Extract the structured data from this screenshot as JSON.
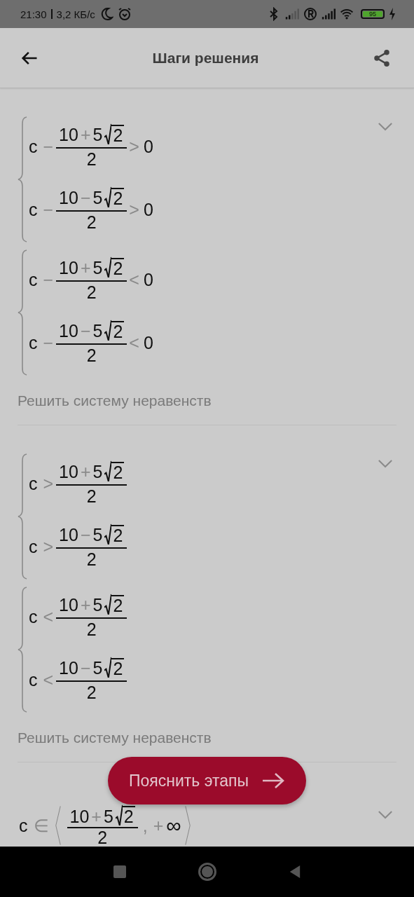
{
  "status_bar": {
    "time": "21:30",
    "speed": "3,2 КБ/с",
    "battery": "95"
  },
  "header": {
    "title": "Шаги решения"
  },
  "steps": [
    {
      "systems": [
        {
          "rows": [
            {
              "kind": "difference",
              "variable": "c",
              "operator": "−",
              "numerator": {
                "a": "10",
                "sign": "+",
                "b": "5",
                "radicand": "2"
              },
              "denominator": "2",
              "relation": ">",
              "rhs": "0"
            },
            {
              "kind": "difference",
              "variable": "c",
              "operator": "−",
              "numerator": {
                "a": "10",
                "sign": "−",
                "b": "5",
                "radicand": "2"
              },
              "denominator": "2",
              "relation": ">",
              "rhs": "0"
            }
          ]
        },
        {
          "rows": [
            {
              "kind": "difference",
              "variable": "c",
              "operator": "−",
              "numerator": {
                "a": "10",
                "sign": "+",
                "b": "5",
                "radicand": "2"
              },
              "denominator": "2",
              "relation": "<",
              "rhs": "0"
            },
            {
              "kind": "difference",
              "variable": "c",
              "operator": "−",
              "numerator": {
                "a": "10",
                "sign": "−",
                "b": "5",
                "radicand": "2"
              },
              "denominator": "2",
              "relation": "<",
              "rhs": "0"
            }
          ]
        }
      ],
      "caption": "Решить систему неравенств"
    },
    {
      "systems": [
        {
          "rows": [
            {
              "kind": "comparison",
              "variable": "c",
              "relation": ">",
              "numerator": {
                "a": "10",
                "sign": "+",
                "b": "5",
                "radicand": "2"
              },
              "denominator": "2"
            },
            {
              "kind": "comparison",
              "variable": "c",
              "relation": ">",
              "numerator": {
                "a": "10",
                "sign": "−",
                "b": "5",
                "radicand": "2"
              },
              "denominator": "2"
            }
          ]
        },
        {
          "rows": [
            {
              "kind": "comparison",
              "variable": "c",
              "relation": "<",
              "numerator": {
                "a": "10",
                "sign": "+",
                "b": "5",
                "radicand": "2"
              },
              "denominator": "2"
            },
            {
              "kind": "comparison",
              "variable": "c",
              "relation": "<",
              "numerator": {
                "a": "10",
                "sign": "−",
                "b": "5",
                "radicand": "2"
              },
              "denominator": "2"
            }
          ]
        }
      ],
      "caption": "Решить систему неравенств"
    },
    {
      "rows": [
        {
          "kind": "interval",
          "variable": "c",
          "relation": "∈",
          "numerator": {
            "a": "10",
            "sign": "+",
            "b": "5",
            "radicand": "2"
          },
          "denominator": "2",
          "separator": ",",
          "sign": "+",
          "bound": "∞"
        }
      ]
    }
  ],
  "fab": {
    "label": "Пояснить этапы"
  }
}
